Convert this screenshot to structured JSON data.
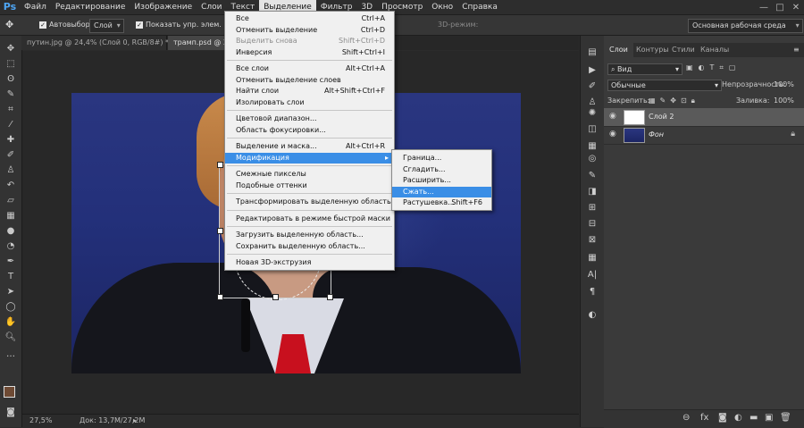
{
  "app": {
    "logo": "Ps"
  },
  "menubar": {
    "items": [
      "Файл",
      "Редактирование",
      "Изображение",
      "Слои",
      "Текст",
      "Выделение",
      "Фильтр",
      "3D",
      "Просмотр",
      "Окно",
      "Справка"
    ],
    "active_index": 5
  },
  "window_controls": {
    "minimize": "—",
    "maximize": "□",
    "close": "✕"
  },
  "options": {
    "autoselect_label": "Автовыбор:",
    "autoselect_value": "Слой",
    "show_controls_label": "Показать упр. элем.",
    "mode_3d_label": "3D-режим:",
    "workspace": "Основная рабочая среда"
  },
  "tabs": [
    {
      "label": "путин.jpg @ 24,4% (Слой 0, RGB/8#) *",
      "active": false
    },
    {
      "label": "трамп.psd @ 27,5",
      "active": true
    }
  ],
  "status": {
    "zoom": "27,5%",
    "doc": "Док: 13,7M/27,2M"
  },
  "select_menu": {
    "groups": [
      [
        {
          "label": "Все",
          "shortcut": "Ctrl+A",
          "disabled": false
        },
        {
          "label": "Отменить выделение",
          "shortcut": "Ctrl+D",
          "disabled": false
        },
        {
          "label": "Выделить снова",
          "shortcut": "Shift+Ctrl+D",
          "disabled": true
        },
        {
          "label": "Инверсия",
          "shortcut": "Shift+Ctrl+I",
          "disabled": false
        }
      ],
      [
        {
          "label": "Все слои",
          "shortcut": "Alt+Ctrl+A",
          "disabled": false
        },
        {
          "label": "Отменить выделение слоев",
          "shortcut": "",
          "disabled": false
        },
        {
          "label": "Найти слои",
          "shortcut": "Alt+Shift+Ctrl+F",
          "disabled": false
        },
        {
          "label": "Изолировать слои",
          "shortcut": "",
          "disabled": false
        }
      ],
      [
        {
          "label": "Цветовой диапазон...",
          "shortcut": "",
          "disabled": false
        },
        {
          "label": "Область фокусировки...",
          "shortcut": "",
          "disabled": false
        }
      ],
      [
        {
          "label": "Выделение и маска...",
          "shortcut": "Alt+Ctrl+R",
          "disabled": false
        },
        {
          "label": "Модификация",
          "shortcut": "",
          "disabled": false,
          "submenu": true,
          "highlighted": true
        }
      ],
      [
        {
          "label": "Смежные пикселы",
          "shortcut": "",
          "disabled": false
        },
        {
          "label": "Подобные оттенки",
          "shortcut": "",
          "disabled": false
        }
      ],
      [
        {
          "label": "Трансформировать выделенную область",
          "shortcut": "",
          "disabled": false
        }
      ],
      [
        {
          "label": "Редактировать в режиме быстрой маски",
          "shortcut": "",
          "disabled": false
        }
      ],
      [
        {
          "label": "Загрузить выделенную область...",
          "shortcut": "",
          "disabled": false
        },
        {
          "label": "Сохранить выделенную область...",
          "shortcut": "",
          "disabled": false
        }
      ],
      [
        {
          "label": "Новая 3D-экструзия",
          "shortcut": "",
          "disabled": false
        }
      ]
    ]
  },
  "modify_submenu": [
    {
      "label": "Граница...",
      "shortcut": "",
      "highlighted": false
    },
    {
      "label": "Сгладить...",
      "shortcut": "",
      "highlighted": false
    },
    {
      "label": "Расширить...",
      "shortcut": "",
      "highlighted": false
    },
    {
      "label": "Сжать...",
      "shortcut": "",
      "highlighted": true
    },
    {
      "label": "Растушевка...",
      "shortcut": "Shift+F6",
      "highlighted": false
    }
  ],
  "layers_panel": {
    "tabs": [
      "Слои",
      "Контуры",
      "Стили",
      "Каналы"
    ],
    "active_tab": 0,
    "filter_label": "Вид",
    "blend_mode": "Обычные",
    "opacity_label": "Непрозрачность:",
    "opacity_value": "100%",
    "lock_label": "Закрепить:",
    "fill_label": "Заливка:",
    "fill_value": "100%",
    "layers": [
      {
        "name": "Слой 2",
        "selected": true,
        "locked": false
      },
      {
        "name": "Фон",
        "selected": false,
        "locked": true
      }
    ]
  },
  "colors": {
    "accent": "#3a8ee6",
    "menu_bg": "#f0f0f0",
    "panel_bg": "#3a3a3a"
  }
}
